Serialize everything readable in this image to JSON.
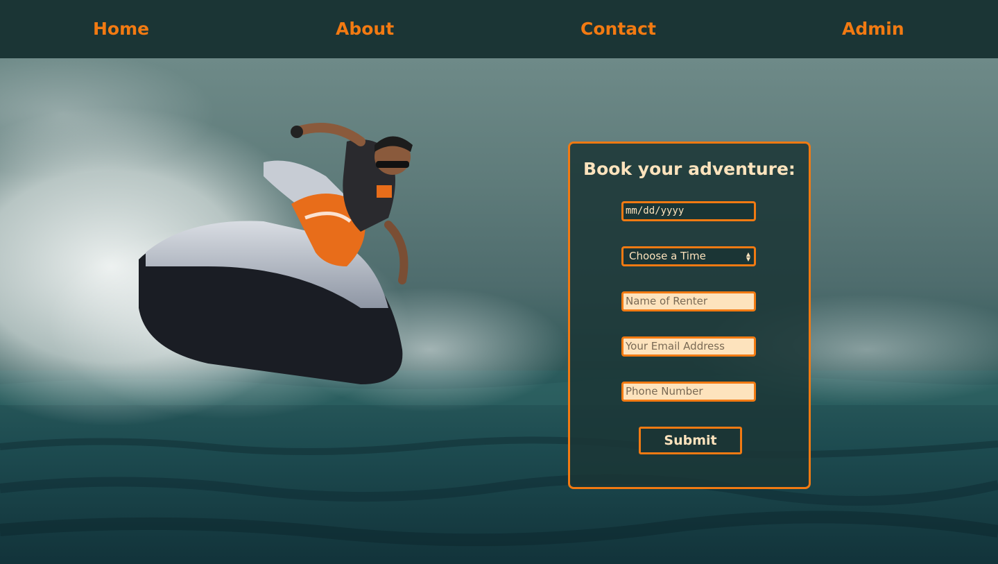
{
  "nav": {
    "items": [
      {
        "label": "Home"
      },
      {
        "label": "About"
      },
      {
        "label": "Contact"
      },
      {
        "label": "Admin"
      }
    ]
  },
  "colors": {
    "accent": "#f27a12",
    "navbar_bg": "#1b3535",
    "cream": "#fde3bd"
  },
  "hero": {
    "image": "jet-ski-rider-on-ocean-wave"
  },
  "booking": {
    "title": "Book your adventure:",
    "date_placeholder": "mm/dd/yyyy",
    "time_select_value": "Choose a Time",
    "name_placeholder": "Name of Renter",
    "email_placeholder": "Your Email Address",
    "phone_placeholder": "Phone Number",
    "submit_label": "Submit"
  }
}
